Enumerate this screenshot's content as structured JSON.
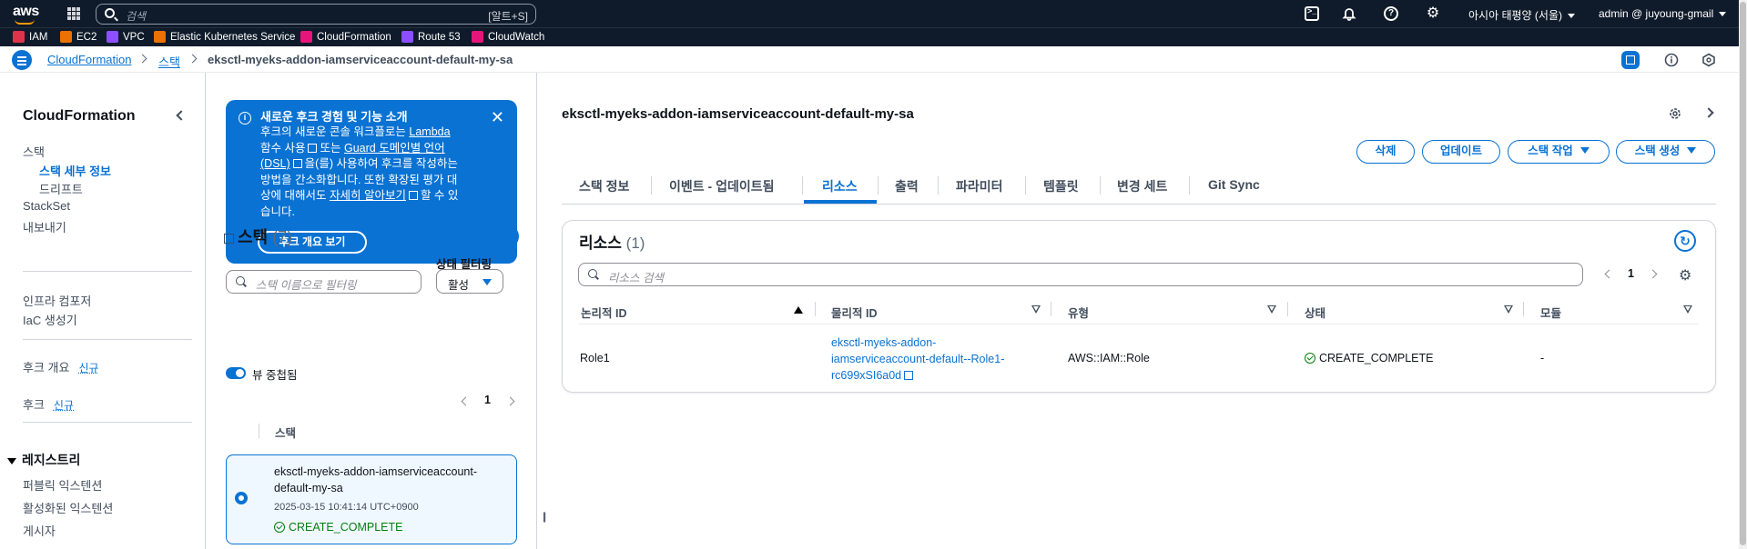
{
  "topnav": {
    "search_placeholder": "검색",
    "search_shortcut": "[알트+S]",
    "region": "아시아 태평양 (서울)",
    "user": "admin @ juyoung-gmail"
  },
  "favorites": [
    {
      "label": "IAM",
      "color": "#dd344c"
    },
    {
      "label": "EC2",
      "color": "#ed7100"
    },
    {
      "label": "VPC",
      "color": "#8c4fff"
    },
    {
      "label": "Elastic Kubernetes Service",
      "color": "#ed7100"
    },
    {
      "label": "CloudFormation",
      "color": "#e7157b"
    },
    {
      "label": "Route 53",
      "color": "#8c4fff"
    },
    {
      "label": "CloudWatch",
      "color": "#e7157b"
    }
  ],
  "breadcrumb": {
    "root": "CloudFormation",
    "middle": "스택",
    "current": "eksctl-myeks-addon-iamserviceaccount-default-my-sa"
  },
  "leftnav": {
    "title": "CloudFormation",
    "stacks": "스택",
    "stack_details": "스택 세부 정보",
    "drifts": "드리프트",
    "stacksets": "StackSet",
    "exports": "내보내기",
    "infra_composer": "인프라 컴포저",
    "iac_generator": "IaC 생성기",
    "hooks_overview": "후크 개요",
    "hooks": "후크",
    "new_badge": "신규",
    "registry": "레지스트리",
    "public_extensions": "퍼블릭 익스텐션",
    "activated_extensions": "활성화된 익스텐션",
    "publishers": "게시자"
  },
  "hookbox": {
    "heading": "새로운 후크 경험 및 기능 소개",
    "line1": "후크의 새로운 콘솔 워크플로는",
    "link_lambda": "Lambda",
    "line2a": "함수 사용",
    "line2b": "또는",
    "link_guard": "Guard 도메인별 언어",
    "link_dsl": "(DSL)",
    "line3": "을(를) 사용하여 후크를 작성하는",
    "line4": "방법을 간소화합니다. 또한 확장된 평가 대",
    "line5a": "상에 대해서도",
    "link_more": "자세히 알아보기",
    "line5b": "할 수 있",
    "line6": "습니다.",
    "button": "후크 개요 보기"
  },
  "stacklist": {
    "title": "스택",
    "count": "(7)",
    "status_filter_label": "상태 필터링",
    "search_placeholder": "스택 이름으로 필터링",
    "status_value": "활성",
    "nested_toggle": "뷰 중첩됨",
    "page": "1",
    "column_header": "스택",
    "selected_stack": {
      "name_line1": "eksctl-myeks-addon-iamserviceaccount-",
      "name_line2": "default-my-sa",
      "timestamp": "2025-03-15 10:41:14 UTC+0900",
      "status": "CREATE_COMPLETE"
    }
  },
  "main": {
    "title": "eksctl-myeks-addon-iamserviceaccount-default-my-sa",
    "buttons": {
      "delete": "삭제",
      "update": "업데이트",
      "stack_actions": "스택 작업",
      "create_stack": "스택 생성"
    },
    "tabs": [
      "스택 정보",
      "이벤트 - 업데이트됨",
      "리소스",
      "출력",
      "파라미터",
      "템플릿",
      "변경 세트",
      "Git Sync"
    ],
    "active_tab": "리소스"
  },
  "resources": {
    "title": "리소스",
    "count": "(1)",
    "search_placeholder": "리소스 검색",
    "page": "1",
    "columns": [
      "논리적 ID",
      "물리적 ID",
      "유형",
      "상태",
      "모듈"
    ],
    "rows": [
      {
        "logical_id": "Role1",
        "physical_id_line1": "eksctl-myeks-addon-",
        "physical_id_line2": "iamserviceaccount-default--Role1-",
        "physical_id_line3": "rc699xSI6a0d",
        "type": "AWS::IAM::Role",
        "status": "CREATE_COMPLETE",
        "module": "-"
      }
    ]
  },
  "colors": {
    "accent": "#0972d3",
    "nav_bg": "#0f1b2a",
    "success": "#037f0c"
  }
}
